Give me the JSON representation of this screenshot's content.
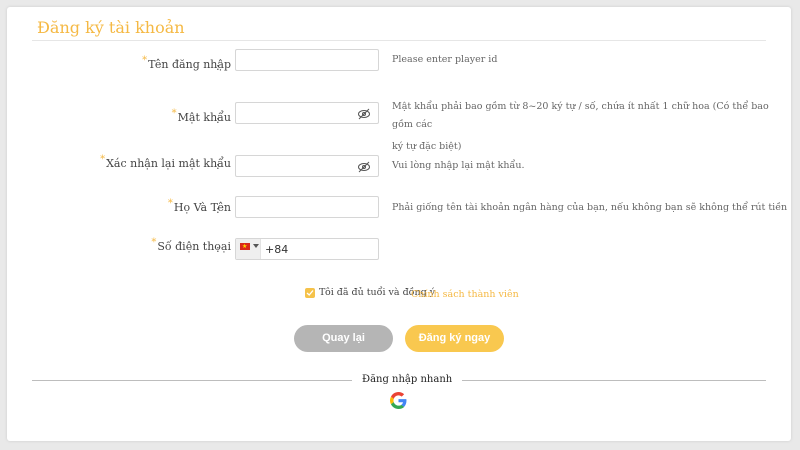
{
  "page": {
    "title": "Đăng ký tài khoản"
  },
  "form": {
    "required_mark": "*",
    "colon": ":",
    "username": {
      "label": "Tên đăng nhập",
      "value": "",
      "hint": "Please enter player id"
    },
    "password": {
      "label": "Mật khẩu",
      "value": "",
      "hint_line1": "Mật khẩu phải bao gồm từ 8~20 ký tự / số, chứa ít nhất 1 chữ hoa (Có thể bao gồm các",
      "hint_line2": "ký tự đặc biệt)",
      "toggle_icon": "eye-off-icon"
    },
    "confirm_password": {
      "label": "Xác nhận lại mật khẩu",
      "value": "",
      "hint": "Vui lòng nhập lại mật khẩu.",
      "toggle_icon": "eye-off-icon"
    },
    "full_name": {
      "label": "Họ Và Tên",
      "value": "",
      "hint": "Phải giống tên tài khoản ngân hàng của bạn, nếu không bạn sẽ không thể rút tiền"
    },
    "phone": {
      "label": "Số điện thoại",
      "country_flag": "vietnam-flag-icon",
      "prefix": "+84",
      "value": ""
    }
  },
  "agreement": {
    "checked": true,
    "text": "Tôi đã đủ tuổi và đồng ý",
    "link": "Chính sách thành viên"
  },
  "buttons": {
    "back": "Quay lại",
    "register": "Đăng ký ngay"
  },
  "quick_login": {
    "label": "Đăng nhập nhanh",
    "provider_icon": "google-icon"
  },
  "colors": {
    "accent": "#f5b944",
    "button_back": "#b5b5b5",
    "button_register": "#f9c84f"
  }
}
